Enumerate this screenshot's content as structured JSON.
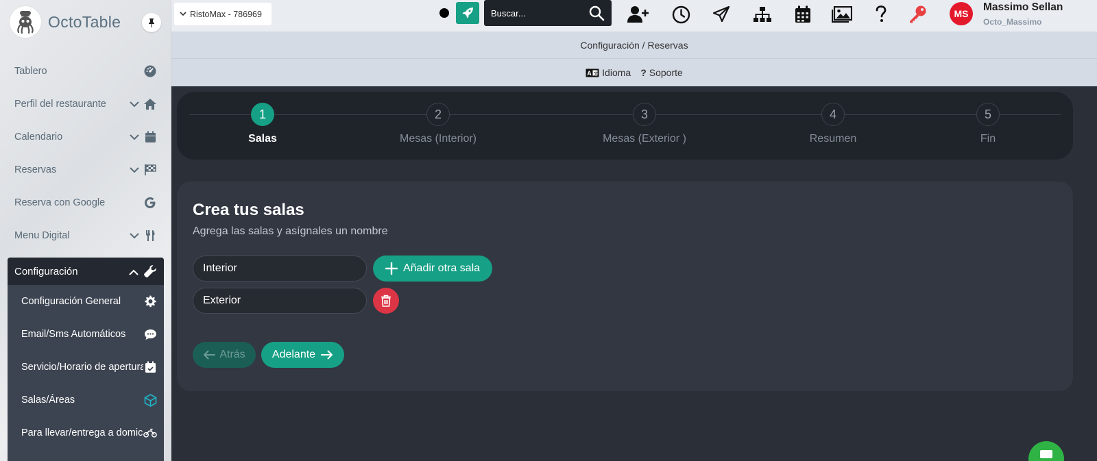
{
  "brand": {
    "name": "OctoTable"
  },
  "sidebar": {
    "items": [
      {
        "label": "Tablero",
        "icon": "dashboard-icon",
        "has_chevron": false
      },
      {
        "label": "Perfil del restaurante",
        "icon": "home-icon",
        "has_chevron": true
      },
      {
        "label": "Calendario",
        "icon": "calendar-icon",
        "has_chevron": true
      },
      {
        "label": "Reservas",
        "icon": "flag-checkered-icon",
        "has_chevron": true
      },
      {
        "label": "Reserva con Google",
        "icon": "google-icon",
        "has_chevron": false
      },
      {
        "label": "Menu Digital",
        "icon": "utensils-icon",
        "has_chevron": true
      }
    ],
    "config": {
      "label": "Configuración",
      "subitems": [
        {
          "label": "Configuración General",
          "icon": "gear-icon"
        },
        {
          "label": "Email/Sms Automáticos",
          "icon": "chat-bubble-icon"
        },
        {
          "label": "Servicio/Horario de apertura",
          "icon": "calendar-check-icon"
        },
        {
          "label": "Salas/Áreas",
          "icon": "cube-icon",
          "active": true
        },
        {
          "label": "Para llevar/entrega a domicilio",
          "icon": "motorcycle-icon"
        }
      ]
    }
  },
  "topbar": {
    "venue": "RistoMax - 786969",
    "search_placeholder": "Buscar...",
    "icons": [
      "add-user-icon",
      "clock-icon",
      "send-icon",
      "sitemap-icon",
      "calendar-icon",
      "images-icon",
      "help-icon",
      "key-icon"
    ],
    "user": {
      "initials": "MS",
      "name": "Massimo Sellan",
      "handle": "Octo_Massimo"
    }
  },
  "breadcrumb": "Configuración / Reservas",
  "helpbar": {
    "language": "Idioma",
    "support": "Soporte"
  },
  "stepper": {
    "steps": [
      {
        "num": "1",
        "label": "Salas",
        "active": true
      },
      {
        "num": "2",
        "label": "Mesas (Interior)",
        "active": false
      },
      {
        "num": "3",
        "label": "Mesas (Exterior )",
        "active": false
      },
      {
        "num": "4",
        "label": "Resumen",
        "active": false
      },
      {
        "num": "5",
        "label": "Fin",
        "active": false
      }
    ]
  },
  "card": {
    "title": "Crea tus salas",
    "subtitle": "Agrega las salas y asígnales un nombre",
    "rooms": [
      "Interior",
      "Exterior"
    ],
    "add_label": "Añadir otra sala",
    "back_label": "Atrás",
    "next_label": "Adelante"
  },
  "colors": {
    "accent": "#16a085",
    "danger": "#dc3545",
    "avatar": "#e3192b"
  }
}
